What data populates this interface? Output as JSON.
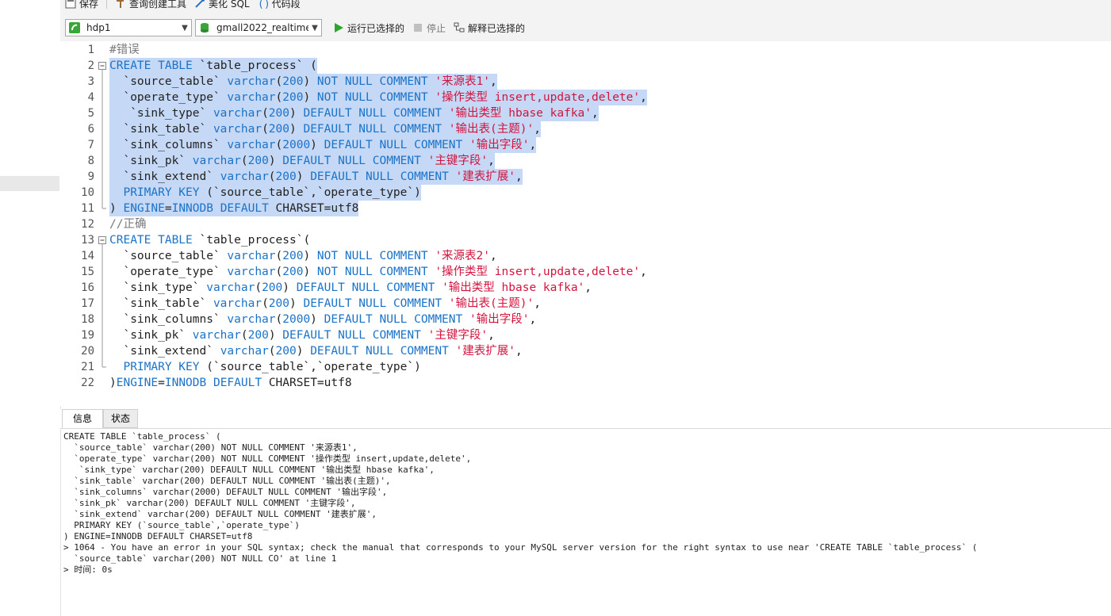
{
  "toolbar": {
    "save": "保存",
    "query_builder": "查询创建工具",
    "beautify": "美化 SQL",
    "snippet": "代码段",
    "connection": "hdp1",
    "database": "gmall2022_realtime",
    "run_selected": "运行已选择的",
    "stop": "停止",
    "explain_selected": "解释已选择的"
  },
  "colors": {
    "keyword": "#1a73c9",
    "string": "#d3143e",
    "comment": "#7a7a7a",
    "selection": "#c5d8f5"
  },
  "editor_lines": [
    {
      "n": "1",
      "fold": "",
      "hl": false,
      "tokens": [
        [
          "cm",
          "#错误"
        ]
      ]
    },
    {
      "n": "2",
      "fold": "box",
      "hl": true,
      "tokens": [
        [
          "kw",
          "CREATE TABLE "
        ],
        [
          "tx",
          "`table_process` ("
        ]
      ]
    },
    {
      "n": "3",
      "fold": "bar",
      "hl": true,
      "tokens": [
        [
          "tx",
          "  `source_table` "
        ],
        [
          "kw",
          "varchar"
        ],
        [
          "tx",
          "("
        ],
        [
          "num",
          "200"
        ],
        [
          "tx",
          ") "
        ],
        [
          "kw",
          "NOT NULL COMMENT "
        ],
        [
          "str",
          "'来源表1'"
        ],
        [
          "tx",
          ","
        ]
      ]
    },
    {
      "n": "4",
      "fold": "bar",
      "hl": true,
      "tokens": [
        [
          "tx",
          "  `operate_type` "
        ],
        [
          "kw",
          "varchar"
        ],
        [
          "tx",
          "("
        ],
        [
          "num",
          "200"
        ],
        [
          "tx",
          ") "
        ],
        [
          "kw",
          "NOT NULL COMMENT "
        ],
        [
          "str",
          "'操作类型 insert,update,delete'"
        ],
        [
          "tx",
          ","
        ]
      ]
    },
    {
      "n": "5",
      "fold": "bar",
      "hl": true,
      "tokens": [
        [
          "tx",
          "   `sink_type` "
        ],
        [
          "kw",
          "varchar"
        ],
        [
          "tx",
          "("
        ],
        [
          "num",
          "200"
        ],
        [
          "tx",
          ") "
        ],
        [
          "kw",
          "DEFAULT NULL COMMENT "
        ],
        [
          "str",
          "'输出类型 hbase kafka'"
        ],
        [
          "tx",
          ","
        ]
      ]
    },
    {
      "n": "6",
      "fold": "bar",
      "hl": true,
      "tokens": [
        [
          "tx",
          "  `sink_table` "
        ],
        [
          "kw",
          "varchar"
        ],
        [
          "tx",
          "("
        ],
        [
          "num",
          "200"
        ],
        [
          "tx",
          ") "
        ],
        [
          "kw",
          "DEFAULT NULL COMMENT "
        ],
        [
          "str",
          "'输出表(主题)'"
        ],
        [
          "tx",
          ","
        ]
      ]
    },
    {
      "n": "7",
      "fold": "bar",
      "hl": true,
      "tokens": [
        [
          "tx",
          "  `sink_columns` "
        ],
        [
          "kw",
          "varchar"
        ],
        [
          "tx",
          "("
        ],
        [
          "num",
          "2000"
        ],
        [
          "tx",
          ") "
        ],
        [
          "kw",
          "DEFAULT NULL COMMENT "
        ],
        [
          "str",
          "'输出字段'"
        ],
        [
          "tx",
          ","
        ]
      ]
    },
    {
      "n": "8",
      "fold": "bar",
      "hl": true,
      "tokens": [
        [
          "tx",
          "  `sink_pk` "
        ],
        [
          "kw",
          "varchar"
        ],
        [
          "tx",
          "("
        ],
        [
          "num",
          "200"
        ],
        [
          "tx",
          ") "
        ],
        [
          "kw",
          "DEFAULT NULL COMMENT "
        ],
        [
          "str",
          "'主键字段'"
        ],
        [
          "tx",
          ","
        ]
      ]
    },
    {
      "n": "9",
      "fold": "bar",
      "hl": true,
      "tokens": [
        [
          "tx",
          "  `sink_extend` "
        ],
        [
          "kw",
          "varchar"
        ],
        [
          "tx",
          "("
        ],
        [
          "num",
          "200"
        ],
        [
          "tx",
          ") "
        ],
        [
          "kw",
          "DEFAULT NULL COMMENT "
        ],
        [
          "str",
          "'建表扩展'"
        ],
        [
          "tx",
          ","
        ]
      ]
    },
    {
      "n": "10",
      "fold": "bar",
      "hl": true,
      "tokens": [
        [
          "kw",
          "  PRIMARY KEY "
        ],
        [
          "tx",
          "(`source_table`,`operate_type`)"
        ]
      ]
    },
    {
      "n": "11",
      "fold": "end",
      "hl": true,
      "tokens": [
        [
          "tx",
          ") "
        ],
        [
          "kw",
          "ENGINE"
        ],
        [
          "tx",
          "="
        ],
        [
          "kw",
          "INNODB DEFAULT "
        ],
        [
          "tx",
          "CHARSET=utf8"
        ]
      ]
    },
    {
      "n": "12",
      "fold": "",
      "hl": false,
      "tokens": [
        [
          "cm",
          "//正确"
        ]
      ]
    },
    {
      "n": "13",
      "fold": "box",
      "hl": false,
      "tokens": [
        [
          "kw",
          "CREATE TABLE "
        ],
        [
          "tx",
          "`table_process`("
        ]
      ]
    },
    {
      "n": "14",
      "fold": "bar",
      "hl": false,
      "tokens": [
        [
          "tx",
          "  `source_table` "
        ],
        [
          "kw",
          "varchar"
        ],
        [
          "tx",
          "("
        ],
        [
          "num",
          "200"
        ],
        [
          "tx",
          ") "
        ],
        [
          "kw",
          "NOT NULL COMMENT "
        ],
        [
          "str",
          "'来源表2'"
        ],
        [
          "tx",
          ","
        ]
      ]
    },
    {
      "n": "15",
      "fold": "bar",
      "hl": false,
      "tokens": [
        [
          "tx",
          "  `operate_type` "
        ],
        [
          "kw",
          "varchar"
        ],
        [
          "tx",
          "("
        ],
        [
          "num",
          "200"
        ],
        [
          "tx",
          ") "
        ],
        [
          "kw",
          "NOT NULL COMMENT "
        ],
        [
          "str",
          "'操作类型 insert,update,delete'"
        ],
        [
          "tx",
          ","
        ]
      ]
    },
    {
      "n": "16",
      "fold": "bar",
      "hl": false,
      "tokens": [
        [
          "tx",
          "  `sink_type` "
        ],
        [
          "kw",
          "varchar"
        ],
        [
          "tx",
          "("
        ],
        [
          "num",
          "200"
        ],
        [
          "tx",
          ") "
        ],
        [
          "kw",
          "DEFAULT NULL COMMENT "
        ],
        [
          "str",
          "'输出类型 hbase kafka'"
        ],
        [
          "tx",
          ","
        ]
      ]
    },
    {
      "n": "17",
      "fold": "bar",
      "hl": false,
      "tokens": [
        [
          "tx",
          "  `sink_table` "
        ],
        [
          "kw",
          "varchar"
        ],
        [
          "tx",
          "("
        ],
        [
          "num",
          "200"
        ],
        [
          "tx",
          ") "
        ],
        [
          "kw",
          "DEFAULT NULL COMMENT "
        ],
        [
          "str",
          "'输出表(主题)'"
        ],
        [
          "tx",
          ","
        ]
      ]
    },
    {
      "n": "18",
      "fold": "bar",
      "hl": false,
      "tokens": [
        [
          "tx",
          "  `sink_columns` "
        ],
        [
          "kw",
          "varchar"
        ],
        [
          "tx",
          "("
        ],
        [
          "num",
          "2000"
        ],
        [
          "tx",
          ") "
        ],
        [
          "kw",
          "DEFAULT NULL COMMENT "
        ],
        [
          "str",
          "'输出字段'"
        ],
        [
          "tx",
          ","
        ]
      ]
    },
    {
      "n": "19",
      "fold": "bar",
      "hl": false,
      "tokens": [
        [
          "tx",
          "  `sink_pk` "
        ],
        [
          "kw",
          "varchar"
        ],
        [
          "tx",
          "("
        ],
        [
          "num",
          "200"
        ],
        [
          "tx",
          ") "
        ],
        [
          "kw",
          "DEFAULT NULL COMMENT "
        ],
        [
          "str",
          "'主键字段'"
        ],
        [
          "tx",
          ","
        ]
      ]
    },
    {
      "n": "20",
      "fold": "bar",
      "hl": false,
      "tokens": [
        [
          "tx",
          "  `sink_extend` "
        ],
        [
          "kw",
          "varchar"
        ],
        [
          "tx",
          "("
        ],
        [
          "num",
          "200"
        ],
        [
          "tx",
          ") "
        ],
        [
          "kw",
          "DEFAULT NULL COMMENT "
        ],
        [
          "str",
          "'建表扩展'"
        ],
        [
          "tx",
          ","
        ]
      ]
    },
    {
      "n": "21",
      "fold": "end",
      "hl": false,
      "tokens": [
        [
          "kw",
          "  PRIMARY KEY "
        ],
        [
          "tx",
          "(`source_table`,`operate_type`)"
        ]
      ]
    },
    {
      "n": "22",
      "fold": "",
      "hl": false,
      "tokens": [
        [
          "tx",
          ")"
        ],
        [
          "kw",
          "ENGINE"
        ],
        [
          "tx",
          "="
        ],
        [
          "kw",
          "INNODB DEFAULT "
        ],
        [
          "tx",
          "CHARSET=utf8"
        ]
      ]
    }
  ],
  "result_tabs": {
    "info": "信息",
    "status": "状态"
  },
  "output_lines": [
    "CREATE TABLE `table_process` (",
    "  `source_table` varchar(200) NOT NULL COMMENT '来源表1',",
    "  `operate_type` varchar(200) NOT NULL COMMENT '操作类型 insert,update,delete',",
    "   `sink_type` varchar(200) DEFAULT NULL COMMENT '输出类型 hbase kafka',",
    "  `sink_table` varchar(200) DEFAULT NULL COMMENT '输出表(主题)',",
    "  `sink_columns` varchar(2000) DEFAULT NULL COMMENT '输出字段',",
    "  `sink_pk` varchar(200) DEFAULT NULL COMMENT '主键字段',",
    "  `sink_extend` varchar(200) DEFAULT NULL COMMENT '建表扩展',",
    "  PRIMARY KEY (`source_table`,`operate_type`)",
    ") ENGINE=INNODB DEFAULT CHARSET=utf8",
    "> 1064 - You have an error in your SQL syntax; check the manual that corresponds to your MySQL server version for the right syntax to use near 'CREATE TABLE `table_process` (",
    "  `source_table` varchar(200) NOT NULL CO' at line 1",
    "> 时间: 0s"
  ]
}
